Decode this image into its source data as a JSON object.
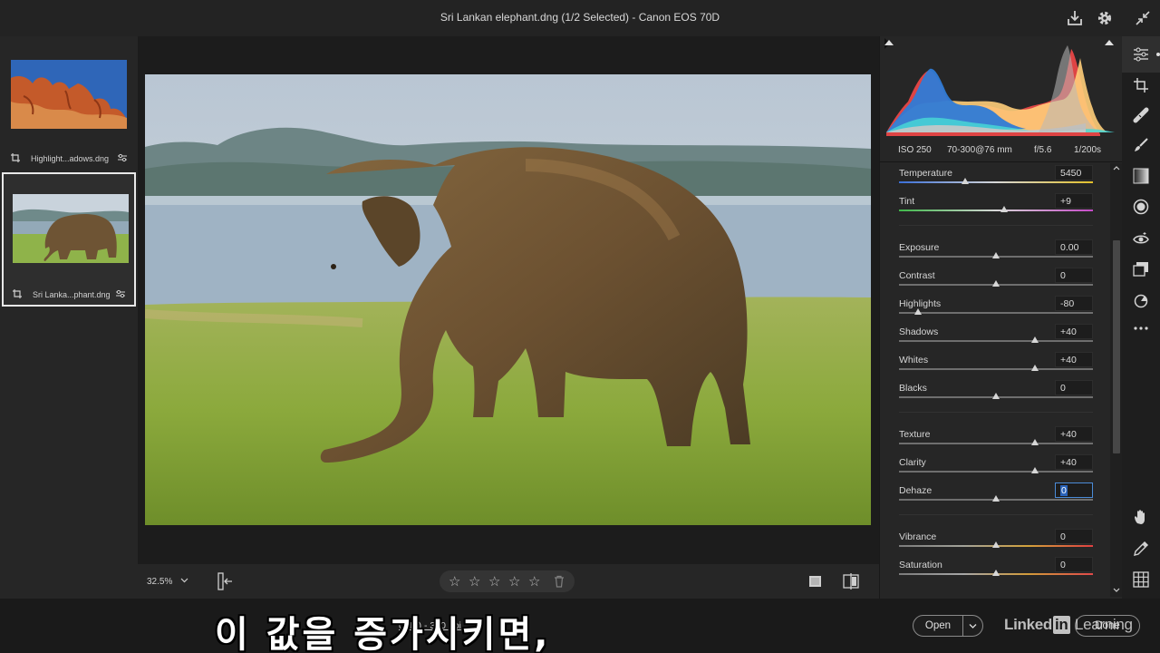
{
  "window": {
    "title": "Sri Lankan elephant.dng (1/2 Selected)  -  Canon EOS 70D",
    "icons": [
      "save-icon",
      "gear-icon",
      "collapse-icon"
    ]
  },
  "filmstrip": {
    "items": [
      {
        "name": "Highlight...adows.dng",
        "selected": false,
        "thumb": "red rock formations under blue sky"
      },
      {
        "name": "Sri Lanka...phant.dng",
        "selected": true,
        "thumb": "elephant on grass"
      }
    ]
  },
  "bottom_toolbar": {
    "zoom": "32.5%",
    "rating": 0,
    "stars": [
      "☆",
      "☆",
      "☆",
      "☆",
      "☆"
    ]
  },
  "histogram": {
    "iso": "ISO 250",
    "lens": "70-300@76 mm",
    "aperture": "f/5.6",
    "shutter": "1/200s"
  },
  "sliders": [
    {
      "label": "Temperature",
      "value": "5450",
      "fraction": 0.34,
      "track": "temp"
    },
    {
      "label": "Tint",
      "value": "+9",
      "fraction": 0.54,
      "track": "tint"
    },
    {
      "label": "Exposure",
      "value": "0.00",
      "fraction": 0.5,
      "track": "plain"
    },
    {
      "label": "Contrast",
      "value": "0",
      "fraction": 0.5,
      "track": "plain"
    },
    {
      "label": "Highlights",
      "value": "-80",
      "fraction": 0.1,
      "track": "plain"
    },
    {
      "label": "Shadows",
      "value": "+40",
      "fraction": 0.7,
      "track": "plain"
    },
    {
      "label": "Whites",
      "value": "+40",
      "fraction": 0.7,
      "track": "plain"
    },
    {
      "label": "Blacks",
      "value": "0",
      "fraction": 0.5,
      "track": "plain"
    },
    {
      "label": "Texture",
      "value": "+40",
      "fraction": 0.7,
      "track": "plain"
    },
    {
      "label": "Clarity",
      "value": "+40",
      "fraction": 0.7,
      "track": "plain"
    },
    {
      "label": "Dehaze",
      "value": "0",
      "fraction": 0.5,
      "track": "plain",
      "active": true
    },
    {
      "label": "Vibrance",
      "value": "0",
      "fraction": 0.5,
      "track": "vibrance"
    },
    {
      "label": "Saturation",
      "value": "0",
      "fraction": 0.5,
      "track": "saturation"
    }
  ],
  "tools": [
    "edit-icon",
    "crop-icon",
    "healing-icon",
    "brush-icon",
    "gradient-icon",
    "radial-icon",
    "redeye-icon",
    "presets-icon",
    "snapshots-icon",
    "more-icon",
    "hand-icon",
    "eyedropper-icon",
    "grid-icon"
  ],
  "footer": {
    "info": "0MP) - 300 ppi",
    "open_label": "Open",
    "done_label": "Done",
    "watermark_pre": "Linked",
    "watermark_in": "in",
    "watermark_post": " Learning",
    "subtitle": "이 값을 증가시키면,"
  },
  "colors": {
    "accent": "#2a63b9",
    "panel": "#262626",
    "background": "#1f1f1f"
  }
}
